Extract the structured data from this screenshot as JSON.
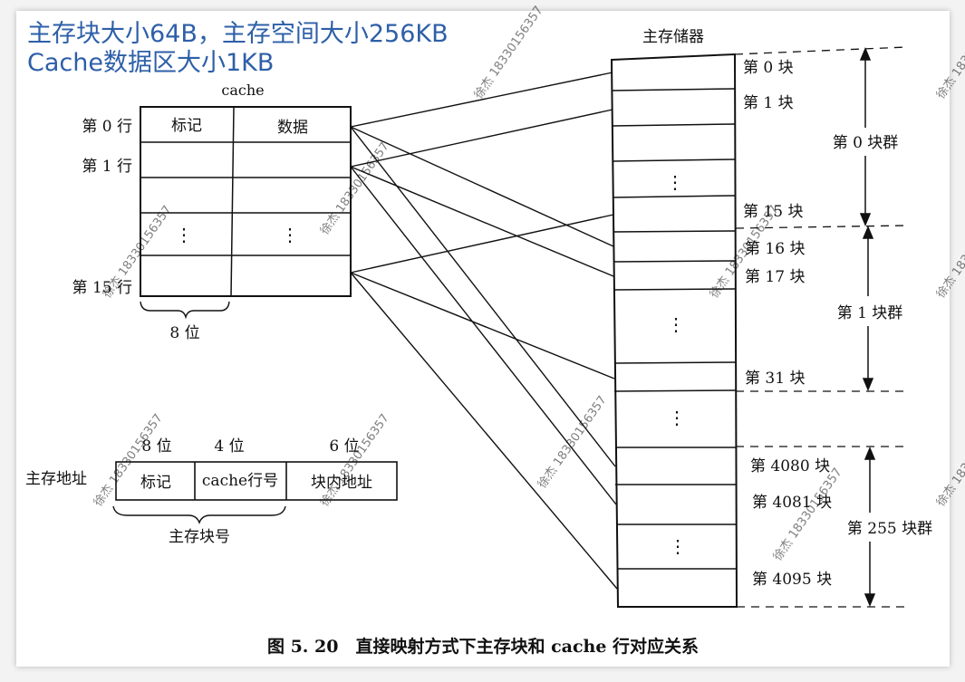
{
  "annotation": {
    "line1": "主存块大小64B，主存空间大小256KB",
    "line2": "Cache数据区大小1KB"
  },
  "cache": {
    "title": "cache",
    "header_tag": "标记",
    "header_data": "数据",
    "row_labels": [
      "第 0 行",
      "第 1 行",
      "第 15 行"
    ],
    "ellipsis": "⋮",
    "tag_width_label": "8 位"
  },
  "memory": {
    "title": "主存储器",
    "block_labels": [
      "第 0 块",
      "第 1 块",
      "第 15 块",
      "第 16 块",
      "第 17 块",
      "第 31 块",
      "第 4080 块",
      "第 4081 块",
      "第 4095 块"
    ],
    "group_labels": [
      "第 0 块群",
      "第 1 块群",
      "第 255 块群"
    ],
    "ellipsis": "⋮"
  },
  "address": {
    "label": "主存地址",
    "fields": [
      "标记",
      "cache行号",
      "块内地址"
    ],
    "widths": [
      "8 位",
      "4 位",
      "6 位"
    ],
    "block_number_label": "主存块号"
  },
  "caption": "图 5. 20　直接映射方式下主存块和 cache 行对应关系",
  "watermark": "徐杰 18330156357",
  "colors": {
    "annotation": "#2d5fa8",
    "line": "#111111",
    "watermark": "#c8c8c8"
  }
}
